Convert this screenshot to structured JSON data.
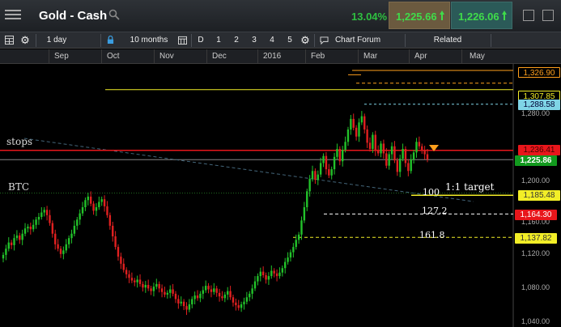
{
  "window": {
    "title": "Gold - Cash",
    "change_pct": "13.04%",
    "sell_price": "1,225.66",
    "buy_price": "1,226.06"
  },
  "toolbar": {
    "interval": "1 day",
    "range": "10 months",
    "btn_d": "D",
    "btn_1": "1",
    "btn_2": "2",
    "btn_3": "3",
    "btn_4": "4",
    "btn_5": "5",
    "chart_forum": "Chart Forum",
    "related": "Related"
  },
  "months": [
    "Sep",
    "Oct",
    "Nov",
    "Dec",
    "2016",
    "Feb",
    "Mar",
    "Apr",
    "May"
  ],
  "price_axis": [
    "1,200.00",
    "1,160.00",
    "1,120.00",
    "1,080.00",
    "1,040.00"
  ],
  "price_badges": {
    "orange_top": "1,326.90",
    "yellow_top": "1,307.85",
    "blue": "1,288.58",
    "red_line": "1,236.41",
    "current": "1,225.86",
    "yellow_100": "1,185.48",
    "red_127": "1,164.30",
    "yellow_161": "1,137.82",
    "partial_axis": "1,280.00"
  },
  "annotations": {
    "stops": "stops",
    "btc": "BTC",
    "target": "1:1 target",
    "fib_100": "100",
    "fib_127": "127.2",
    "fib_161": "161.8"
  },
  "colors": {
    "up": "#22c22a",
    "down": "#e02020",
    "orange": "#ff9f1c",
    "yellow": "#f2ee27",
    "blue": "#7fd4e6",
    "red": "#e8161b",
    "green_badge": "#129a1e"
  },
  "chart_data": {
    "type": "candlestick",
    "symbol": "Gold - Cash",
    "price_range": [
      1040,
      1340
    ],
    "x_labels": [
      "Sep",
      "Oct",
      "Nov",
      "Dec",
      "2016",
      "Feb",
      "Mar",
      "Apr",
      "May"
    ],
    "closes": [
      1118,
      1125,
      1132,
      1129,
      1137,
      1140,
      1135,
      1142,
      1148,
      1150,
      1147,
      1152,
      1158,
      1161,
      1166,
      1169,
      1163,
      1154,
      1142,
      1130,
      1125,
      1119,
      1123,
      1130,
      1137,
      1142,
      1151,
      1158,
      1165,
      1172,
      1180,
      1184,
      1176,
      1168,
      1172,
      1178,
      1181,
      1173,
      1163,
      1151,
      1139,
      1127,
      1116,
      1108,
      1101,
      1096,
      1092,
      1089,
      1087,
      1090,
      1085,
      1081,
      1084,
      1080,
      1077,
      1082,
      1085,
      1080,
      1076,
      1073,
      1075,
      1079,
      1074,
      1068,
      1063,
      1065,
      1060,
      1056,
      1062,
      1068,
      1072,
      1069,
      1074,
      1078,
      1083,
      1079,
      1076,
      1080,
      1075,
      1071,
      1069,
      1073,
      1077,
      1070,
      1064,
      1061,
      1058,
      1062,
      1065,
      1070,
      1074,
      1080,
      1088,
      1094,
      1099,
      1095,
      1090,
      1094,
      1100,
      1097,
      1094,
      1098,
      1103,
      1110,
      1115,
      1121,
      1127,
      1135,
      1141,
      1157,
      1172,
      1190,
      1204,
      1213,
      1203,
      1209,
      1222,
      1230,
      1215,
      1208,
      1215,
      1229,
      1238,
      1224,
      1237,
      1246,
      1260,
      1272,
      1262,
      1252,
      1268,
      1275,
      1260,
      1245,
      1238,
      1254,
      1236,
      1233,
      1244,
      1233,
      1219,
      1232,
      1241,
      1225,
      1212,
      1227,
      1238,
      1222,
      1213,
      1226,
      1234,
      1246,
      1241,
      1237,
      1232,
      1226
    ],
    "levels": [
      {
        "label": "1,326.90",
        "value": 1326.9,
        "style": "orange-solid"
      },
      {
        "label": "1,307.85",
        "value": 1307.85,
        "style": "yellow-solid"
      },
      {
        "label": "1,288.58",
        "value": 1288.58,
        "style": "blue-dashed"
      },
      {
        "label": "stops",
        "value": 1236.41,
        "style": "red-solid"
      },
      {
        "label": "100",
        "value": 1185.48,
        "style": "yellow-solid"
      },
      {
        "label": "127.2",
        "value": 1164.3,
        "style": "white-dashed"
      },
      {
        "label": "161.8",
        "value": 1137.82,
        "style": "yellow-dashed"
      }
    ]
  }
}
